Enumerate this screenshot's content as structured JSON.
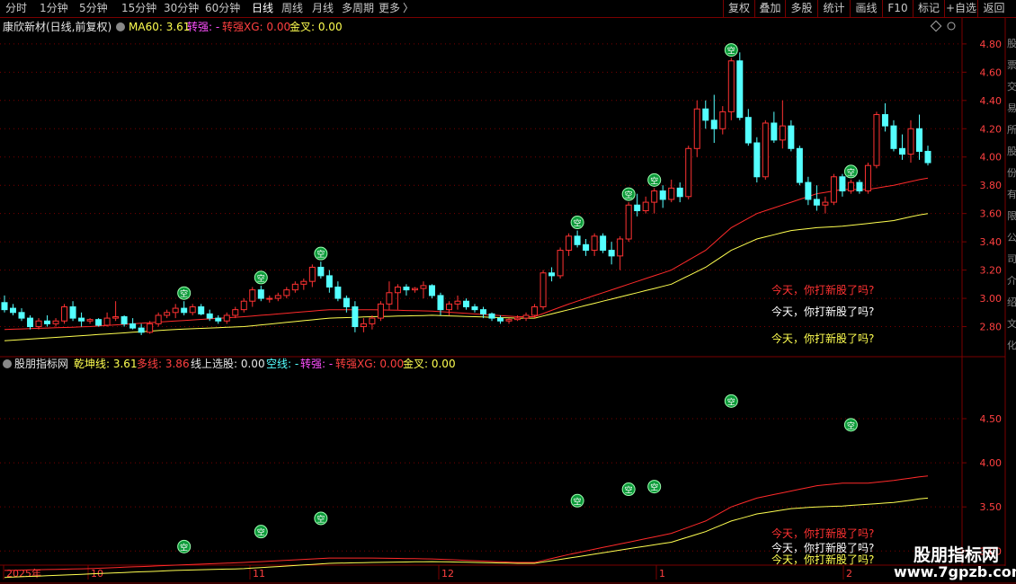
{
  "toolbar": {
    "periods": [
      "分时",
      "1分钟",
      "5分钟",
      "15分钟",
      "30分钟",
      "60分钟",
      "日线",
      "周线",
      "月线",
      "多周期",
      "更多"
    ],
    "active_period": "日线",
    "more_arrow": "〉",
    "right_buttons": [
      "复权",
      "叠加",
      "多股",
      "统计",
      "画线",
      "F10",
      "标记",
      "+自选",
      "返回"
    ]
  },
  "main_panel": {
    "title": "康欣新材(日线,前复权)",
    "ma60_label": "MA60: 3.61",
    "zhuanqiang_label": "转强: -",
    "zhuanqiangxg_label": "转强XG: 0.00",
    "jincha_label": "金叉: 0.00",
    "note_red": "今天，你打新股了吗?",
    "note_white": "今天，你打新股了吗?",
    "note_yellow": "今天，你打新股了吗?",
    "y_ticks": [
      "4.80",
      "4.60",
      "4.40",
      "4.20",
      "4.00",
      "3.80",
      "3.60",
      "3.40",
      "3.20",
      "3.00",
      "2.80"
    ]
  },
  "sub_panel": {
    "title": "股朋指标网",
    "qiankun_label": "乾坤线: 3.61",
    "duoxian_label": "多线: 3.86",
    "xianshangxuangu_label": "线上选股: 0.00",
    "kongxian_label": "空线: -",
    "zhuanqiang_label": "转强: -",
    "zhuanqiangxg_label": "转强XG: 0.00",
    "jincha_label": "金叉: 0.00",
    "note_red": "今天，你打新股了吗?",
    "note_white": "今天，你打新股了吗?",
    "note_yellow": "今天，你打新股了吗?",
    "y_ticks": [
      "4.50",
      "4.00",
      "3.50",
      "3.00"
    ]
  },
  "x_axis": {
    "labels": [
      "2025年",
      "10",
      "11",
      "12",
      "1",
      "2"
    ]
  },
  "marker_glyph": "空",
  "side_strip": [
    "股",
    "票",
    "交",
    "易",
    "所",
    "股",
    "份",
    "有",
    "限",
    "公",
    "司",
    "介",
    "绍",
    "文",
    "化"
  ],
  "watermark": {
    "title": "股朋指标网",
    "url": "www.7gpzb.com"
  },
  "colors": {
    "up": "#ff3232",
    "down": "#54ffff",
    "ma_red": "#ff2a2a",
    "ma_yellow": "#ffff50",
    "grid": "#7a0000",
    "marker_bg": "#0d9b3a",
    "text_grey": "#c8c8c8",
    "magenta": "#ff50ff",
    "cyan": "#54ffff"
  },
  "chart_data": {
    "type": "candlestick",
    "y_range_main": [
      2.6,
      4.92
    ],
    "y_range_sub": [
      2.85,
      5.05
    ],
    "candles": [
      [
        2.97,
        3.02,
        2.9,
        2.92
      ],
      [
        2.93,
        2.96,
        2.88,
        2.9
      ],
      [
        2.9,
        2.93,
        2.84,
        2.86
      ],
      [
        2.86,
        2.88,
        2.78,
        2.8
      ],
      [
        2.8,
        2.86,
        2.78,
        2.84
      ],
      [
        2.84,
        2.88,
        2.8,
        2.82
      ],
      [
        2.82,
        2.86,
        2.8,
        2.84
      ],
      [
        2.84,
        2.96,
        2.82,
        2.94
      ],
      [
        2.94,
        2.98,
        2.84,
        2.86
      ],
      [
        2.86,
        2.9,
        2.8,
        2.84
      ],
      [
        2.84,
        2.86,
        2.82,
        2.85
      ],
      [
        2.85,
        2.86,
        2.8,
        2.81
      ],
      [
        2.81,
        2.9,
        2.8,
        2.86
      ],
      [
        2.86,
        2.98,
        2.84,
        2.87
      ],
      [
        2.87,
        2.88,
        2.8,
        2.82
      ],
      [
        2.82,
        2.86,
        2.78,
        2.79
      ],
      [
        2.79,
        2.82,
        2.74,
        2.76
      ],
      [
        2.76,
        2.84,
        2.75,
        2.82
      ],
      [
        2.82,
        2.9,
        2.8,
        2.88
      ],
      [
        2.88,
        2.92,
        2.86,
        2.9
      ],
      [
        2.9,
        2.96,
        2.86,
        2.93
      ],
      [
        2.93,
        2.98,
        2.88,
        2.9
      ],
      [
        2.9,
        2.96,
        2.88,
        2.94
      ],
      [
        2.94,
        2.96,
        2.88,
        2.89
      ],
      [
        2.89,
        2.92,
        2.84,
        2.86
      ],
      [
        2.86,
        2.88,
        2.82,
        2.84
      ],
      [
        2.84,
        2.9,
        2.82,
        2.88
      ],
      [
        2.88,
        2.94,
        2.86,
        2.92
      ],
      [
        2.92,
        3.0,
        2.9,
        2.98
      ],
      [
        2.98,
        3.08,
        2.94,
        3.06
      ],
      [
        3.06,
        3.09,
        2.98,
        3.0
      ],
      [
        3.0,
        3.02,
        2.97,
        3.0
      ],
      [
        3.0,
        3.04,
        2.98,
        3.02
      ],
      [
        3.02,
        3.08,
        3.0,
        3.06
      ],
      [
        3.06,
        3.12,
        3.04,
        3.1
      ],
      [
        3.1,
        3.14,
        3.06,
        3.12
      ],
      [
        3.12,
        3.24,
        3.08,
        3.22
      ],
      [
        3.22,
        3.26,
        3.14,
        3.16
      ],
      [
        3.16,
        3.2,
        3.04,
        3.08
      ],
      [
        3.08,
        3.12,
        2.98,
        3.0
      ],
      [
        3.0,
        3.02,
        2.9,
        2.94
      ],
      [
        2.94,
        2.98,
        2.76,
        2.8
      ],
      [
        2.8,
        2.86,
        2.76,
        2.82
      ],
      [
        2.82,
        2.88,
        2.78,
        2.86
      ],
      [
        2.86,
        2.98,
        2.84,
        2.96
      ],
      [
        2.96,
        3.12,
        2.92,
        3.04
      ],
      [
        3.04,
        3.1,
        2.92,
        3.08
      ],
      [
        3.08,
        3.1,
        3.02,
        3.06
      ],
      [
        3.06,
        3.08,
        3.04,
        3.07
      ],
      [
        3.07,
        3.12,
        3.0,
        3.09
      ],
      [
        3.09,
        3.1,
        3.0,
        3.02
      ],
      [
        3.02,
        3.04,
        2.88,
        2.92
      ],
      [
        2.92,
        2.98,
        2.88,
        2.96
      ],
      [
        2.96,
        3.02,
        2.92,
        2.98
      ],
      [
        2.98,
        3.0,
        2.92,
        2.94
      ],
      [
        2.94,
        2.96,
        2.9,
        2.92
      ],
      [
        2.92,
        2.94,
        2.86,
        2.89
      ],
      [
        2.89,
        2.9,
        2.84,
        2.86
      ],
      [
        2.86,
        2.88,
        2.82,
        2.84
      ],
      [
        2.84,
        2.86,
        2.82,
        2.85
      ],
      [
        2.85,
        2.88,
        2.84,
        2.86
      ],
      [
        2.86,
        2.9,
        2.84,
        2.88
      ],
      [
        2.88,
        2.96,
        2.86,
        2.94
      ],
      [
        2.94,
        3.2,
        2.92,
        3.18
      ],
      [
        3.18,
        3.22,
        3.12,
        3.16
      ],
      [
        3.16,
        3.36,
        3.14,
        3.34
      ],
      [
        3.34,
        3.46,
        3.3,
        3.44
      ],
      [
        3.44,
        3.48,
        3.36,
        3.38
      ],
      [
        3.38,
        3.42,
        3.3,
        3.34
      ],
      [
        3.34,
        3.46,
        3.3,
        3.44
      ],
      [
        3.44,
        3.46,
        3.32,
        3.34
      ],
      [
        3.34,
        3.4,
        3.24,
        3.3
      ],
      [
        3.3,
        3.44,
        3.2,
        3.42
      ],
      [
        3.42,
        3.68,
        3.4,
        3.66
      ],
      [
        3.66,
        3.74,
        3.58,
        3.62
      ],
      [
        3.62,
        3.72,
        3.6,
        3.68
      ],
      [
        3.68,
        3.78,
        3.6,
        3.76
      ],
      [
        3.76,
        3.8,
        3.64,
        3.7
      ],
      [
        3.7,
        3.84,
        3.68,
        3.78
      ],
      [
        3.78,
        3.82,
        3.68,
        3.72
      ],
      [
        3.72,
        4.08,
        3.7,
        4.06
      ],
      [
        4.06,
        4.4,
        4.0,
        4.34
      ],
      [
        4.34,
        4.4,
        4.2,
        4.26
      ],
      [
        4.26,
        4.44,
        4.1,
        4.2
      ],
      [
        4.2,
        4.36,
        4.16,
        4.32
      ],
      [
        4.32,
        4.7,
        4.26,
        4.68
      ],
      [
        4.68,
        4.74,
        4.26,
        4.28
      ],
      [
        4.28,
        4.34,
        4.08,
        4.1
      ],
      [
        4.1,
        4.14,
        3.82,
        3.86
      ],
      [
        3.86,
        4.26,
        3.84,
        4.24
      ],
      [
        4.24,
        4.32,
        4.1,
        4.12
      ],
      [
        4.12,
        4.4,
        4.06,
        4.22
      ],
      [
        4.22,
        4.26,
        4.04,
        4.06
      ],
      [
        4.06,
        4.08,
        3.8,
        3.82
      ],
      [
        3.82,
        3.86,
        3.66,
        3.7
      ],
      [
        3.7,
        3.8,
        3.62,
        3.66
      ],
      [
        3.66,
        3.72,
        3.6,
        3.68
      ],
      [
        3.68,
        3.88,
        3.66,
        3.86
      ],
      [
        3.86,
        3.88,
        3.72,
        3.76
      ],
      [
        3.76,
        3.84,
        3.74,
        3.82
      ],
      [
        3.82,
        3.84,
        3.74,
        3.76
      ],
      [
        3.76,
        3.96,
        3.74,
        3.94
      ],
      [
        3.94,
        4.32,
        3.92,
        4.3
      ],
      [
        4.3,
        4.38,
        4.18,
        4.22
      ],
      [
        4.22,
        4.26,
        4.04,
        4.06
      ],
      [
        4.06,
        4.16,
        3.98,
        4.02
      ],
      [
        4.02,
        4.26,
        3.96,
        4.2
      ],
      [
        4.2,
        4.3,
        3.98,
        4.04
      ],
      [
        4.04,
        4.08,
        3.94,
        3.96
      ]
    ],
    "ma_red_knots": [
      [
        0,
        2.78
      ],
      [
        10,
        2.8
      ],
      [
        20,
        2.84
      ],
      [
        28,
        2.87
      ],
      [
        38,
        2.92
      ],
      [
        43,
        2.92
      ],
      [
        50,
        2.91
      ],
      [
        55,
        2.89
      ],
      [
        60,
        2.87
      ],
      [
        62,
        2.87
      ],
      [
        66,
        2.96
      ],
      [
        70,
        3.04
      ],
      [
        74,
        3.12
      ],
      [
        78,
        3.2
      ],
      [
        82,
        3.34
      ],
      [
        85,
        3.5
      ],
      [
        88,
        3.6
      ],
      [
        92,
        3.68
      ],
      [
        95,
        3.74
      ],
      [
        98,
        3.77
      ],
      [
        101,
        3.77
      ],
      [
        104,
        3.8
      ],
      [
        107,
        3.84
      ],
      [
        109,
        3.86
      ]
    ],
    "ma_yellow_knots": [
      [
        0,
        2.7
      ],
      [
        10,
        2.74
      ],
      [
        20,
        2.78
      ],
      [
        28,
        2.8
      ],
      [
        38,
        2.86
      ],
      [
        43,
        2.87
      ],
      [
        50,
        2.88
      ],
      [
        55,
        2.87
      ],
      [
        60,
        2.86
      ],
      [
        62,
        2.86
      ],
      [
        66,
        2.92
      ],
      [
        70,
        2.98
      ],
      [
        74,
        3.04
      ],
      [
        78,
        3.1
      ],
      [
        82,
        3.22
      ],
      [
        85,
        3.34
      ],
      [
        88,
        3.42
      ],
      [
        92,
        3.48
      ],
      [
        95,
        3.5
      ],
      [
        98,
        3.51
      ],
      [
        101,
        3.53
      ],
      [
        104,
        3.55
      ],
      [
        107,
        3.59
      ],
      [
        109,
        3.61
      ]
    ],
    "marker_indices": [
      21,
      30,
      37,
      67,
      73,
      76,
      85,
      99
    ],
    "marker_sub_values": [
      3.05,
      3.22,
      3.37,
      3.57,
      3.7,
      3.73,
      4.7,
      4.43
    ]
  }
}
